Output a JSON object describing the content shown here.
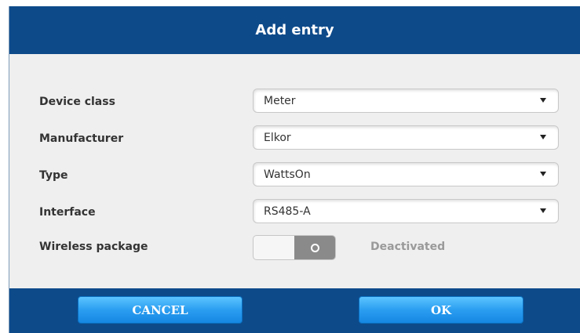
{
  "dialog": {
    "title": "Add entry",
    "fields": [
      {
        "label": "Device class",
        "value": "Meter"
      },
      {
        "label": "Manufacturer",
        "value": "Elkor"
      },
      {
        "label": "Type",
        "value": "WattsOn"
      },
      {
        "label": "Interface",
        "value": "RS485-A"
      }
    ],
    "wireless": {
      "label": "Wireless package",
      "state": "Deactivated",
      "enabled": false
    },
    "buttons": {
      "cancel": "CANCEL",
      "ok": "OK"
    }
  },
  "colors": {
    "header": "#0d4a8a",
    "footer": "#0d4a8a",
    "button": "#2b9ef1",
    "body": "#efefef"
  }
}
